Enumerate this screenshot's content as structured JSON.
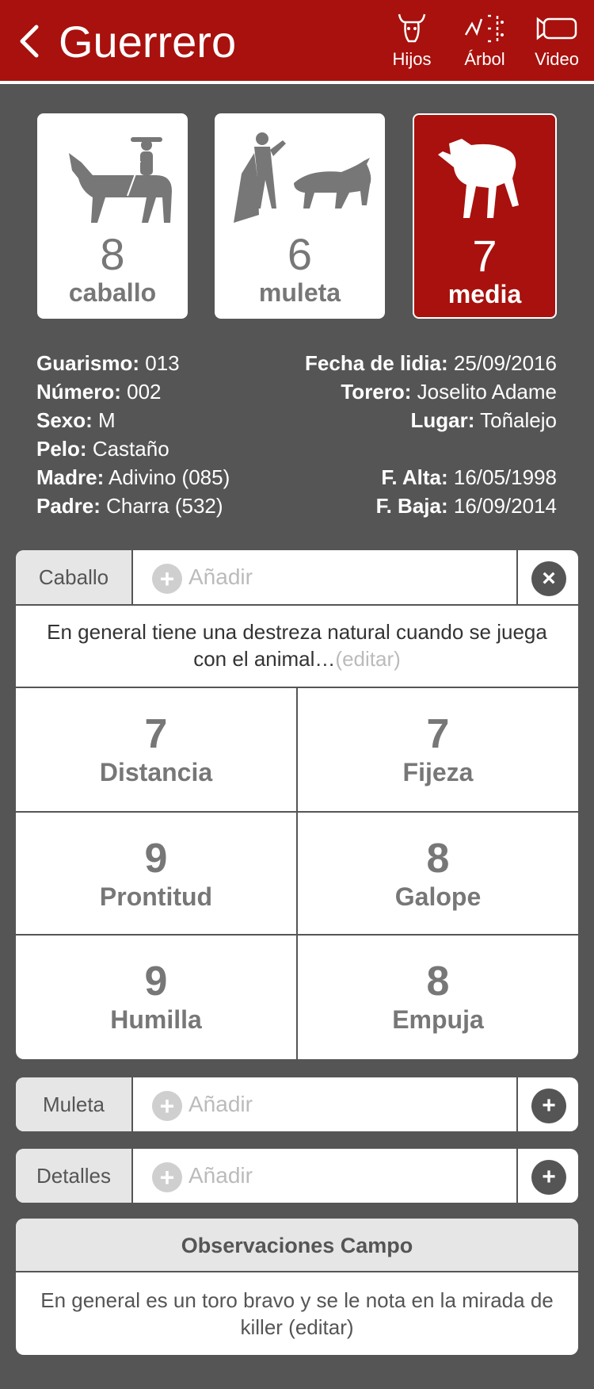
{
  "header": {
    "title": "Guerrero",
    "actions": [
      {
        "label": "Hijos",
        "icon": "bull-head-icon"
      },
      {
        "label": "Árbol",
        "icon": "tree-icon"
      },
      {
        "label": "Video",
        "icon": "video-icon"
      }
    ]
  },
  "scores": [
    {
      "value": "8",
      "label": "caballo",
      "icon": "horse-rider-icon",
      "active": false
    },
    {
      "value": "6",
      "label": "muleta",
      "icon": "matador-bull-icon",
      "active": false
    },
    {
      "value": "7",
      "label": "media",
      "icon": "bull-icon",
      "active": true
    }
  ],
  "info": {
    "guarismo": {
      "label": "Guarismo:",
      "value": "013"
    },
    "numero": {
      "label": "Número:",
      "value": "002"
    },
    "sexo": {
      "label": "Sexo:",
      "value": "M"
    },
    "pelo": {
      "label": "Pelo:",
      "value": "Castaño"
    },
    "madre": {
      "label": "Madre:",
      "value": "Adivino (085)"
    },
    "padre": {
      "label": "Padre:",
      "value": "Charra (532)"
    },
    "fecha": {
      "label": "Fecha de lidia:",
      "value": "25/09/2016"
    },
    "torero": {
      "label": "Torero:",
      "value": "Joselito Adame"
    },
    "lugar": {
      "label": "Lugar:",
      "value": "Toñalejo"
    },
    "alta": {
      "label": "F. Alta:",
      "value": "16/05/1998"
    },
    "baja": {
      "label": "F. Baja:",
      "value": "16/09/2014"
    }
  },
  "caballo": {
    "tab": "Caballo",
    "add": "Añadir",
    "description": "En general tiene una destreza natural cuando se juega con el animal…",
    "edit": "(editar)",
    "stats": [
      {
        "value": "7",
        "label": "Distancia"
      },
      {
        "value": "7",
        "label": "Fijeza"
      },
      {
        "value": "9",
        "label": "Prontitud"
      },
      {
        "value": "8",
        "label": "Galope"
      },
      {
        "value": "9",
        "label": "Humilla"
      },
      {
        "value": "8",
        "label": "Empuja"
      }
    ]
  },
  "muleta": {
    "tab": "Muleta",
    "add": "Añadir"
  },
  "detalles": {
    "tab": "Detalles",
    "add": "Añadir"
  },
  "observaciones": {
    "title": "Observaciones Campo",
    "text": "En general es un toro bravo y se le nota en la mirada de killer (editar)"
  },
  "colors": {
    "brand": "#a8110d",
    "background": "#555555"
  }
}
